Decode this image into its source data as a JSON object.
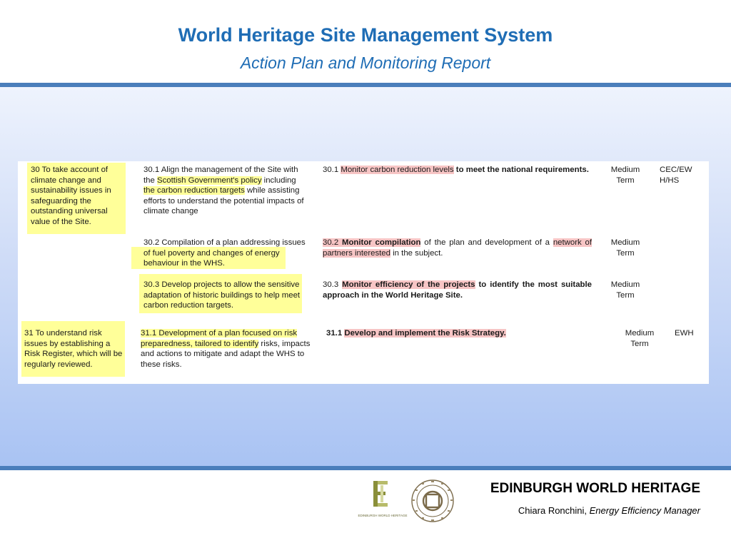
{
  "header": {
    "title": "World Heritage Site Management System",
    "subtitle": "Action Plan and Monitoring Report"
  },
  "table": {
    "obj30": "30 To take account of climate change and sustainability issues in safeguarding the outstanding universal value of the Site.",
    "a30_1": {
      "pre": "30.1 Align the management of the Site with the ",
      "hl1": "Scottish Government's policy",
      "mid": " including ",
      "hl2": "the carbon reduction targets",
      "post": " while assisting efforts to understand the potential impacts of climate change"
    },
    "m30_1": {
      "num": "30.1 ",
      "hl": "Monitor carbon reduction levels",
      "rest": " to meet the national requirements."
    },
    "t30_1_line1": "Medium",
    "t30_1_line2": "Term",
    "r30_1_line1": "CEC/EW",
    "r30_1_line2": "H/HS",
    "a30_2": {
      "pre": "30.2 Compilation of a plan addressing ",
      "hl": "issues of fuel poverty and changes",
      "mid": " of ",
      "hl2": "energy behaviour in the WHS."
    },
    "m30_2": {
      "hl1": "30.2 ",
      "hl2": "Monitor compilation",
      "rest1": " of the plan and development of a ",
      "hl3": "network of partners interested",
      "rest2": " in the subject."
    },
    "t30_2_line1": "Medium",
    "t30_2_line2": "Term",
    "a30_3": "30.3 Develop projects to allow the sensitive adaptation of historic buildings to help meet carbon reduction targets.",
    "m30_3": {
      "num": "30.3 ",
      "hl": "Monitor efficiency of the projects",
      "rest": " to identify the most suitable approach in the World Heritage Site."
    },
    "t30_3_line1": "Medium",
    "t30_3_line2": "Term",
    "obj31": "31 To understand risk issues by establishing a Risk Register, which will be regularly reviewed.",
    "a31_1": {
      "hl": "31.1 Development of a plan focused on risk preparedness, tailored to identify",
      "rest": " risks, impacts and actions to mitigate and adapt the WHS to these risks."
    },
    "m31_1": {
      "num": "31.1 ",
      "hl": "Develop and implement the Risk Strategy."
    },
    "t31_1_line1": "Medium",
    "t31_1_line2": "Term",
    "r31_1": "EWH"
  },
  "footer": {
    "org": "EDINBURGH WORLD HERITAGE",
    "person_name": "Chiara Ronchini,",
    "person_role": "Energy Efficiency Manager",
    "ew_logo_text": "EDINBURGH WORLD HERITAGE"
  },
  "colors": {
    "title_blue": "#1f6db5",
    "rule_blue": "#4a7ebb",
    "highlight_yellow": "#ffff99",
    "highlight_red": "#f7c5c5"
  }
}
